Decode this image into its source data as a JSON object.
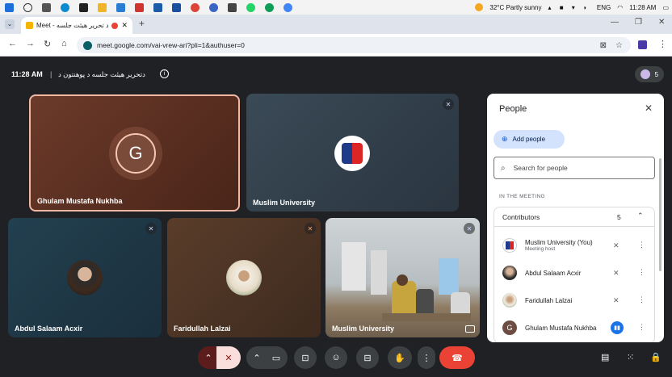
{
  "taskbar": {
    "weather": "32°C  Partly sunny",
    "language": "ENG",
    "time": "11:28 AM"
  },
  "browser": {
    "tab_title": "Meet - د تحریر هیئت جلسه",
    "url": "meet.google.com/vai-vrew-ari?pli=1&authuser=0"
  },
  "meeting": {
    "time": "11:28 AM",
    "separator": "|",
    "title": "دتحریر هیئت جلسه د پوهنتون د",
    "participant_count": "5"
  },
  "tiles": [
    {
      "name": "Ghulam Mustafa Nukhba",
      "initial": "G"
    },
    {
      "name": "Muslim University"
    },
    {
      "name": "Abdul Salaam Acxir"
    },
    {
      "name": "Faridullah Lalzai"
    },
    {
      "name": "Muslim University"
    }
  ],
  "people_panel": {
    "title": "People",
    "add_people": "Add people",
    "search_placeholder": "Search for people",
    "section_label": "IN THE MEETING",
    "group_label": "Contributors",
    "group_count": "5",
    "people": [
      {
        "name": "Muslim University (You)",
        "sub": "Meeting host"
      },
      {
        "name": "Abdul Salaam Acxir",
        "sub": ""
      },
      {
        "name": "Faridullah Lalzai",
        "sub": ""
      },
      {
        "name": "Ghulam Mustafa Nukhba",
        "sub": "",
        "initial": "G"
      }
    ]
  },
  "colors": {
    "accent": "#1a73e8",
    "end_call": "#ea4335",
    "mic_off_bg": "#f9dedc",
    "tile_dark": "#3c4043"
  }
}
